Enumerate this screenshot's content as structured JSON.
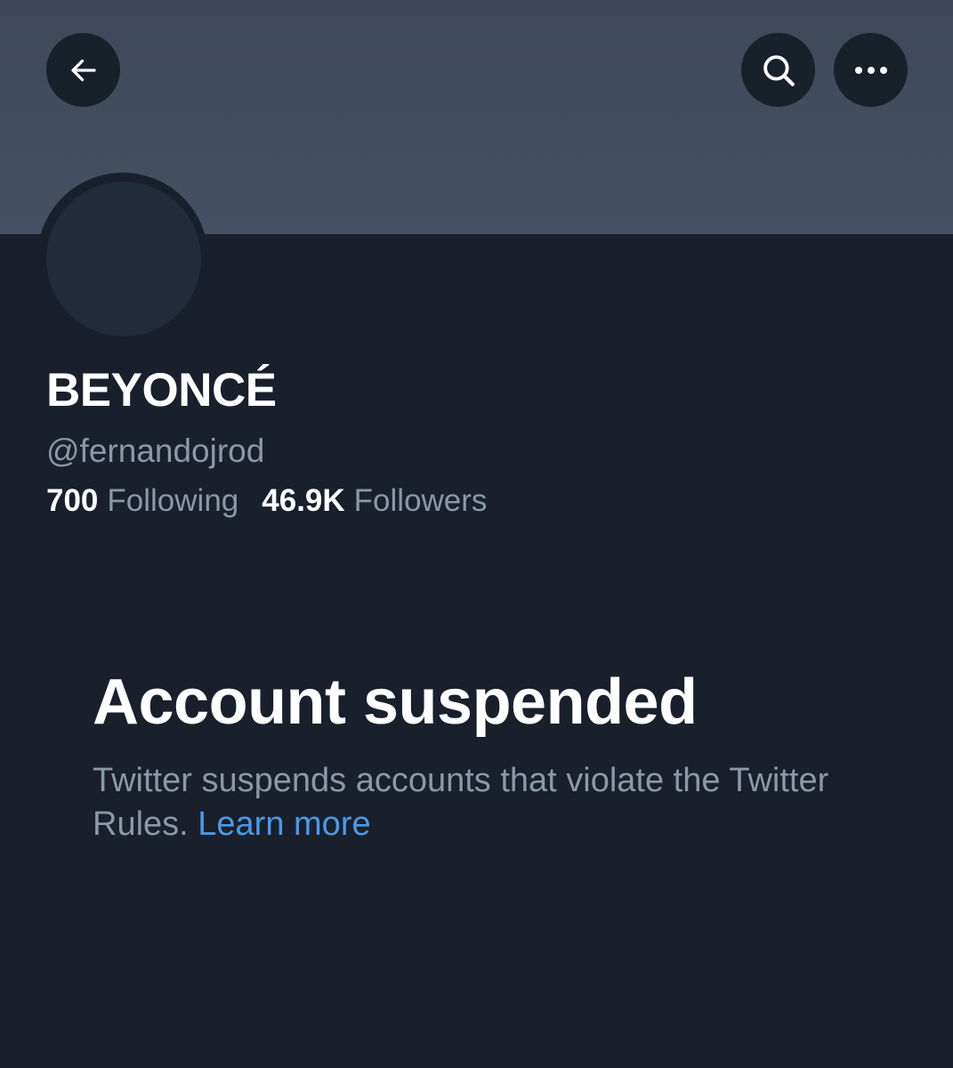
{
  "header": {
    "back_icon": "arrow-left-icon",
    "search_icon": "search-icon",
    "more_icon": "more-horizontal-icon"
  },
  "profile": {
    "display_name": "BEYONCÉ",
    "handle": "@fernandojrod",
    "following_count": "700",
    "following_label": "Following",
    "followers_count": "46.9K",
    "followers_label": "Followers"
  },
  "suspension": {
    "title": "Account suspended",
    "description": "Twitter suspends accounts that violate the Twitter Rules.",
    "learn_more_label": "Learn more"
  },
  "colors": {
    "background": "#19202b",
    "banner": "#435063",
    "button_bg": "#18202a",
    "avatar": "#212b39",
    "text_primary": "#ffffff",
    "text_secondary": "#8b98a5",
    "link": "#4a99e9"
  }
}
